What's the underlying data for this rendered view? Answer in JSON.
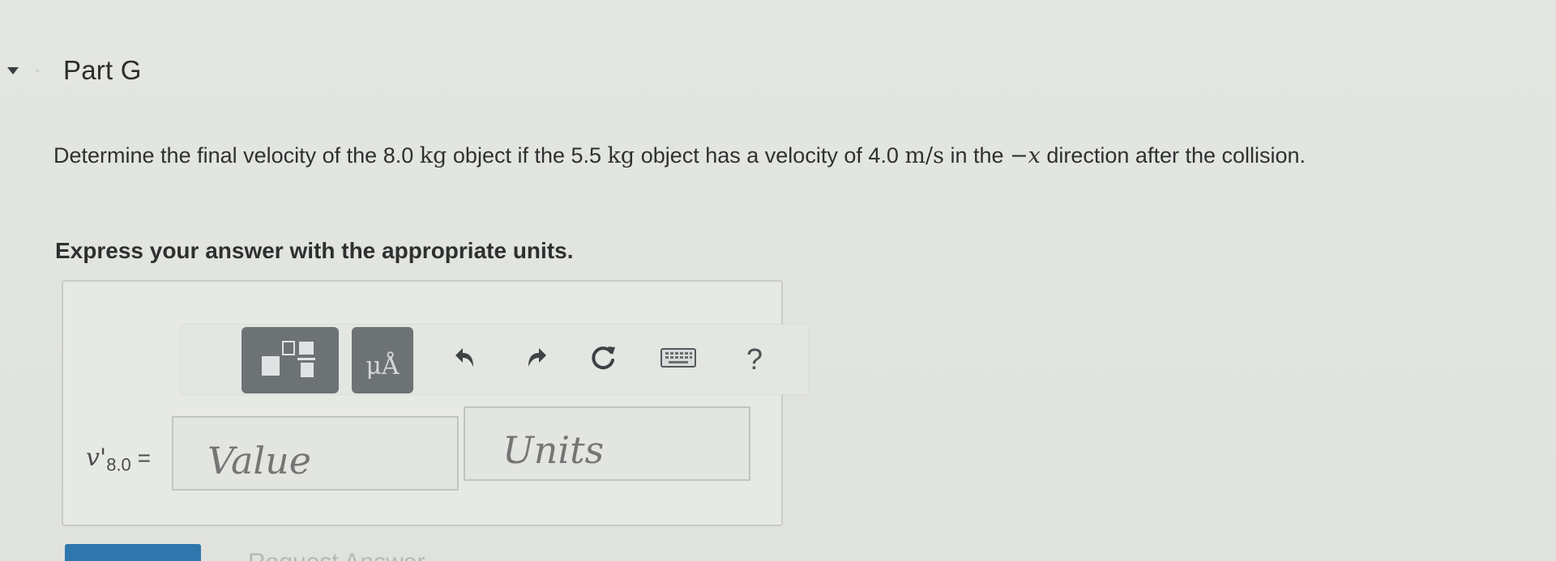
{
  "part": {
    "title": "Part G"
  },
  "question": {
    "text_1": "Determine the final velocity of the 8.0 ",
    "mass_unit_1": "kg",
    "text_2": " object if the 5.5 ",
    "mass_unit_2": "kg",
    "text_3": " object has a velocity of 4.0 ",
    "velocity_unit": "m/s",
    "text_4": " in the ",
    "direction": "−x",
    "text_5": " direction after the collision."
  },
  "instruction": "Express your answer with the appropriate units.",
  "answer": {
    "variable": "v'",
    "subscript": "8.0",
    "equals": "=",
    "value_placeholder": "Value",
    "units_placeholder": "Units"
  },
  "toolbar": {
    "units_button_label": "μÅ",
    "help_label": "?"
  },
  "footer": {
    "request_answer_label": "Request Answer"
  },
  "colors": {
    "accent": "#2f76ad",
    "toolbar_button": "#6d7275"
  },
  "icons": {
    "collapse": "triangle-down-icon",
    "template": "fraction-template-icon",
    "undo": "undo-icon",
    "redo": "redo-icon",
    "reset": "reset-icon",
    "keyboard": "keyboard-icon"
  }
}
